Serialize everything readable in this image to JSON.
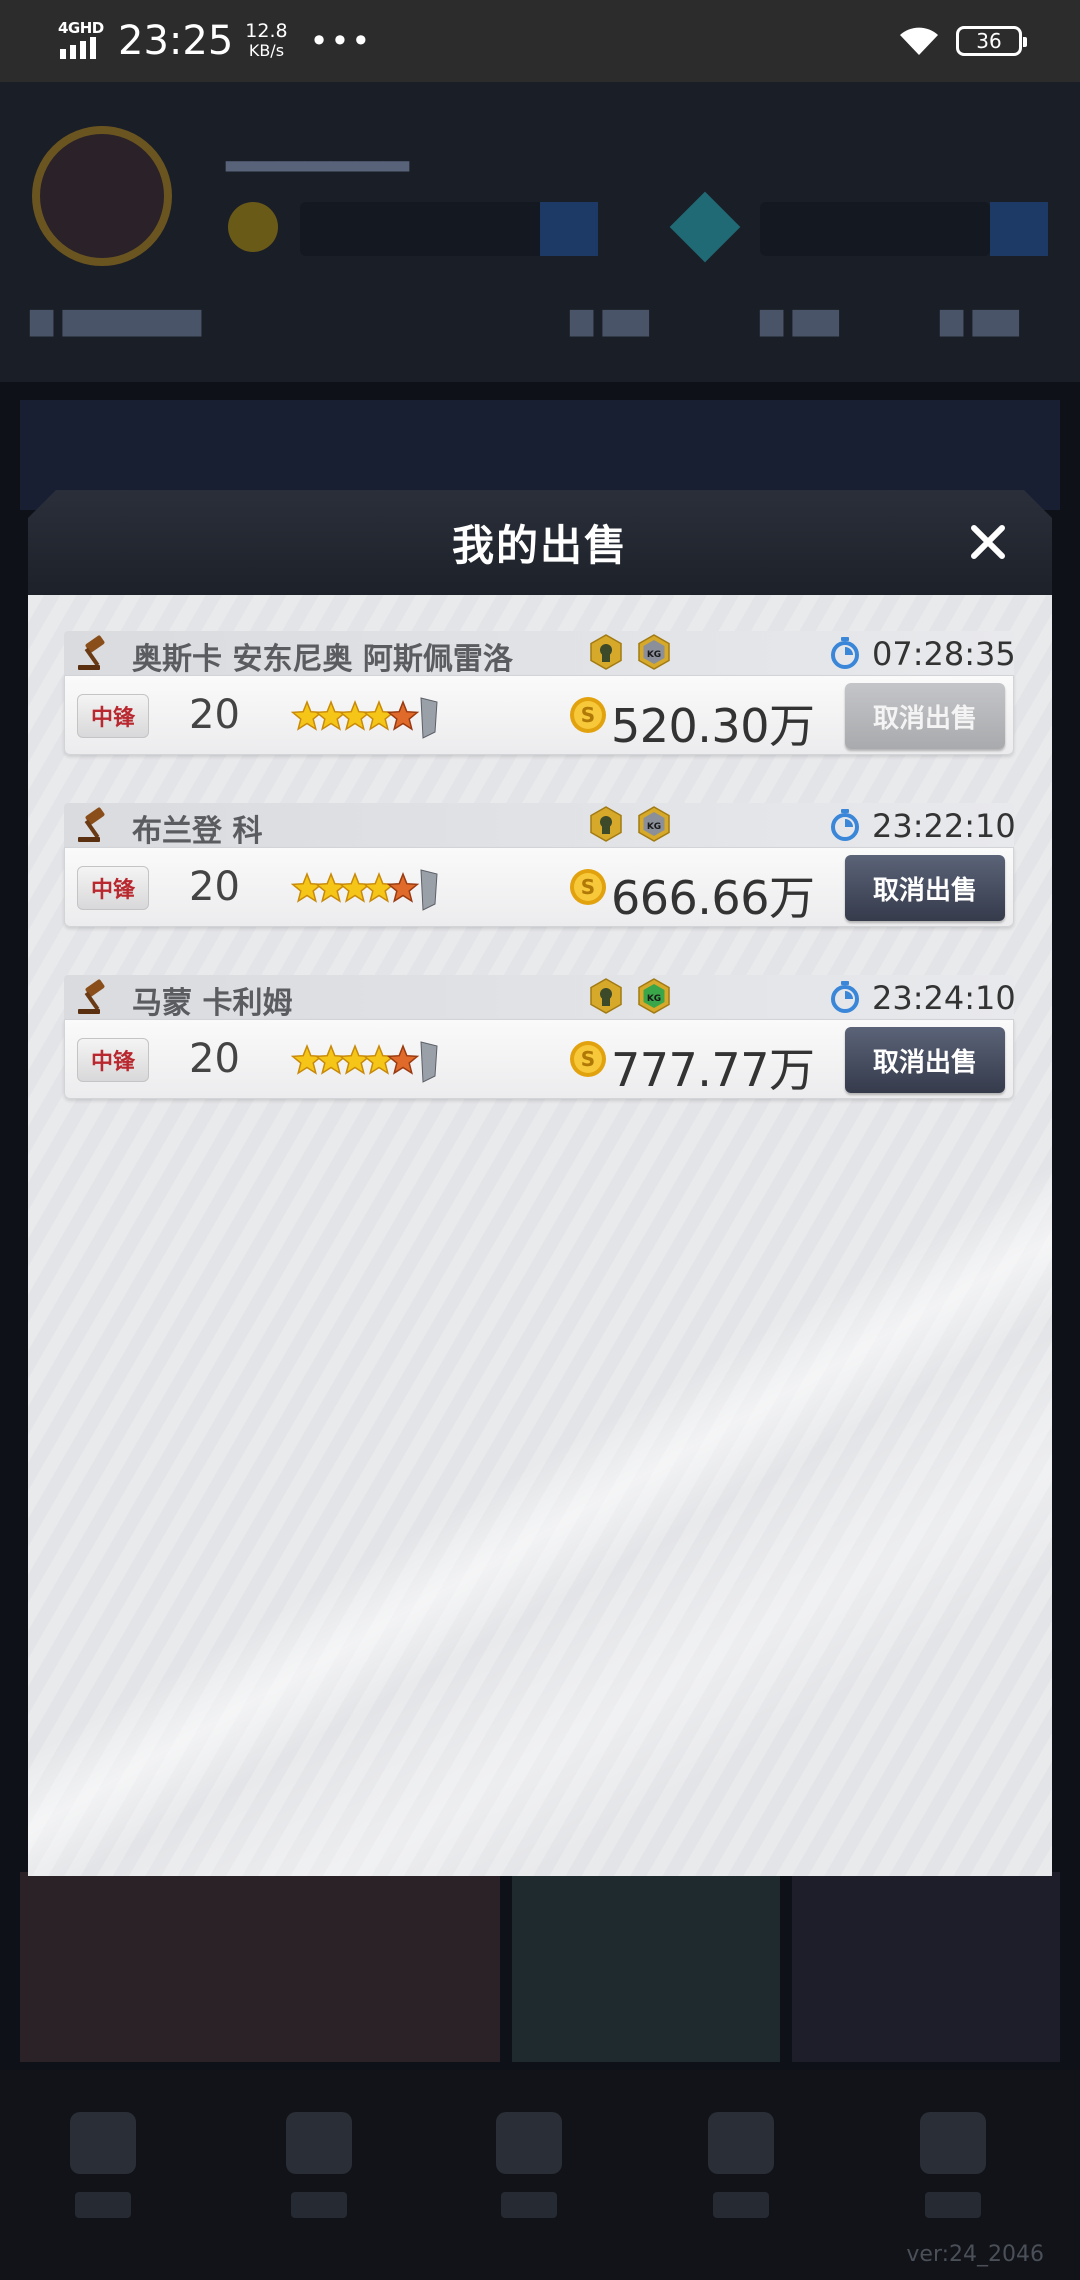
{
  "status_bar": {
    "network": "4GHD",
    "time": "23:25",
    "speed_value": "12.8",
    "speed_unit": "KB/s",
    "more": "•••",
    "battery": "36"
  },
  "background": {
    "version": "ver:24_2046"
  },
  "modal": {
    "title": "我的出售",
    "listings": [
      {
        "name": "奥斯卡 安东尼奥 阿斯佩雷洛",
        "timer": "07:28:35",
        "position": "中锋",
        "level": "20",
        "price": "520.30万",
        "cancel_label": "取消出售",
        "cancel_enabled": false,
        "star_rating": 4.5,
        "badge_b_color": "#8a8f9a"
      },
      {
        "name": "布兰登 科",
        "timer": "23:22:10",
        "position": "中锋",
        "level": "20",
        "price": "666.66万",
        "cancel_label": "取消出售",
        "cancel_enabled": true,
        "star_rating": 4.5,
        "badge_b_color": "#8a8f9a"
      },
      {
        "name": "马蒙 卡利姆",
        "timer": "23:24:10",
        "position": "中锋",
        "level": "20",
        "price": "777.77万",
        "cancel_label": "取消出售",
        "cancel_enabled": true,
        "star_rating": 4.5,
        "badge_b_color": "#3aa64a"
      }
    ]
  },
  "colors": {
    "accent_button": "#3f4659",
    "position_text": "#b8282e",
    "timer_icon": "#3a86d8",
    "coin": "#f0b418"
  }
}
